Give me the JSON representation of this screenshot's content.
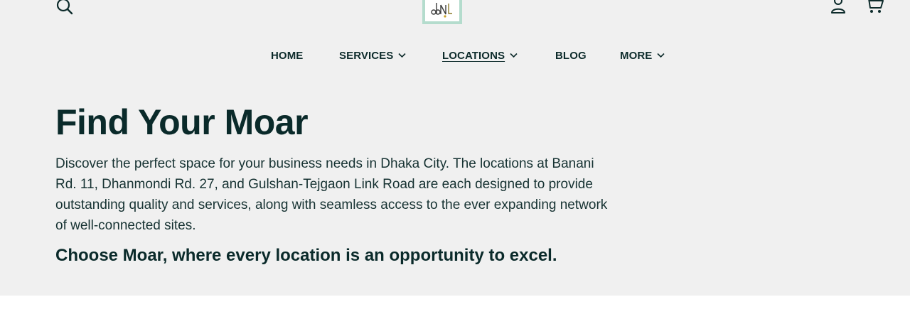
{
  "header": {
    "search_icon": "search-icon",
    "logo_icon": "moar-logo",
    "account_icon": "user-icon",
    "cart_icon": "cart-icon"
  },
  "nav": {
    "items": [
      {
        "label": "HOME",
        "has_dropdown": false,
        "active": false
      },
      {
        "label": "SERVICES",
        "has_dropdown": true,
        "active": false
      },
      {
        "label": "LOCATIONS",
        "has_dropdown": true,
        "active": true
      },
      {
        "label": "BLOG",
        "has_dropdown": false,
        "active": false
      },
      {
        "label": "MORE",
        "has_dropdown": true,
        "active": false
      }
    ]
  },
  "hero": {
    "title": "Find Your Moar",
    "description": "Discover the perfect space for your business needs in Dhaka City. The locations at Banani Rd. 11, Dhanmondi Rd. 27, and Gulshan-Tejgaon Link Road are each designed to provide outstanding quality and services, along with seamless access to the ever expanding network of well-connected sites.",
    "tagline": "Choose Moar, where every location is an opportunity to excel."
  },
  "colors": {
    "hero_background": "#f0f0f0",
    "text_dark": "#0d2b2b",
    "logo_border": "#b4dccd"
  }
}
